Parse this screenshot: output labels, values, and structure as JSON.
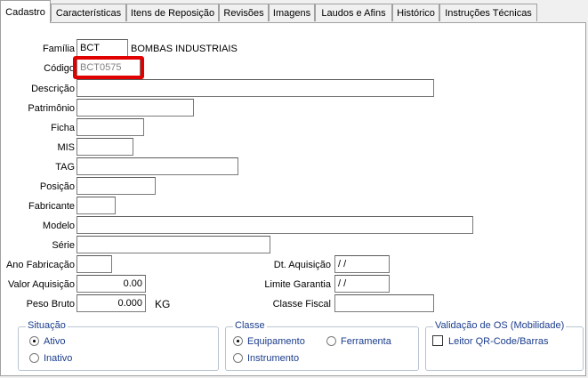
{
  "tabs": [
    "Cadastro",
    "Características",
    "Itens de Reposição",
    "Revisões",
    "Imagens",
    "Laudos e Afins",
    "Histórico",
    "Instruções Técnicas"
  ],
  "fields": {
    "familia": {
      "label": "Família",
      "code": "BCT",
      "description": "BOMBAS INDUSTRIAIS"
    },
    "codigo": {
      "label": "Código",
      "value": "BCT0575"
    },
    "descricao": {
      "label": "Descrição",
      "value": ""
    },
    "patrimonio": {
      "label": "Patrimônio",
      "value": ""
    },
    "ficha": {
      "label": "Ficha",
      "value": ""
    },
    "mis": {
      "label": "MIS",
      "value": ""
    },
    "tag": {
      "label": "TAG",
      "value": ""
    },
    "posicao": {
      "label": "Posição",
      "value": ""
    },
    "fabricante": {
      "label": "Fabricante",
      "value": ""
    },
    "modelo": {
      "label": "Modelo",
      "value": ""
    },
    "serie": {
      "label": "Série",
      "value": ""
    },
    "ano_fabricacao": {
      "label": "Ano Fabricação",
      "value": ""
    },
    "valor_aquisicao": {
      "label": "Valor Aquisição",
      "value": "0.00"
    },
    "peso_bruto": {
      "label": "Peso Bruto",
      "value": "0.000",
      "unit": "KG"
    },
    "dt_aquisicao": {
      "label": "Dt. Aquisição",
      "value": " / /"
    },
    "limite_garantia": {
      "label": "Limite Garantia",
      "value": " / /"
    },
    "classe_fiscal": {
      "label": "Classe Fiscal",
      "value": ""
    }
  },
  "situacao": {
    "title": "Situação",
    "ativo": "Ativo",
    "inativo": "Inativo",
    "selected": "Ativo"
  },
  "classe": {
    "title": "Classe",
    "equipamento": "Equipamento",
    "ferramenta": "Ferramenta",
    "instrumento": "Instrumento",
    "selected": "Equipamento"
  },
  "validacao": {
    "title": "Validação de OS (Mobilidade)",
    "leitor": "Leitor QR-Code/Barras",
    "checked": false
  }
}
